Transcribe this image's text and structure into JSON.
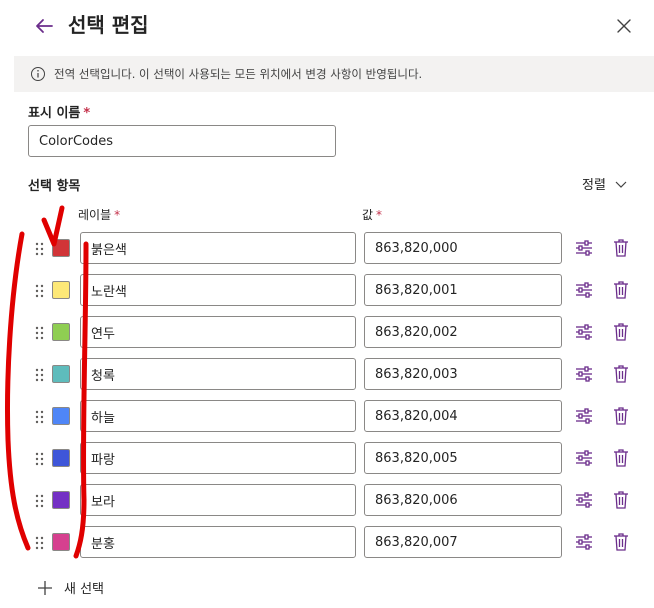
{
  "header": {
    "title": "선택 편집"
  },
  "banner": {
    "text": "전역 선택입니다. 이 선택이 사용되는 모든 위치에서 변경 사항이 반영됩니다."
  },
  "display_name": {
    "label": "표시 이름",
    "required_mark": "*",
    "value": "ColorCodes"
  },
  "choices": {
    "section_label": "선택 항목",
    "sort_label": "정렬",
    "label_column": "레이블",
    "value_column": "값",
    "required_mark": "*",
    "items": [
      {
        "label": "붉은색",
        "value": "863,820,000",
        "color": "#d13438"
      },
      {
        "label": "노란색",
        "value": "863,820,001",
        "color": "#fde877"
      },
      {
        "label": "연두",
        "value": "863,820,002",
        "color": "#8fce52"
      },
      {
        "label": "청록",
        "value": "863,820,003",
        "color": "#5ebcbc"
      },
      {
        "label": "하늘",
        "value": "863,820,004",
        "color": "#4f86f7"
      },
      {
        "label": "파랑",
        "value": "863,820,005",
        "color": "#3e56d9"
      },
      {
        "label": "보라",
        "value": "863,820,006",
        "color": "#7430c4"
      },
      {
        "label": "분홍",
        "value": "863,820,007",
        "color": "#d6408f"
      }
    ],
    "add_label": "새 선택"
  },
  "colors": {
    "accent": "#6b2d8b",
    "annotation": "#e00000"
  },
  "icons": {
    "back": "back-arrow-icon",
    "close": "close-icon",
    "info": "info-icon",
    "grip": "drag-handle-icon",
    "adjust": "settings-sliders-icon",
    "delete": "trash-icon",
    "add": "plus-icon",
    "sort": "chevron-down-icon"
  }
}
